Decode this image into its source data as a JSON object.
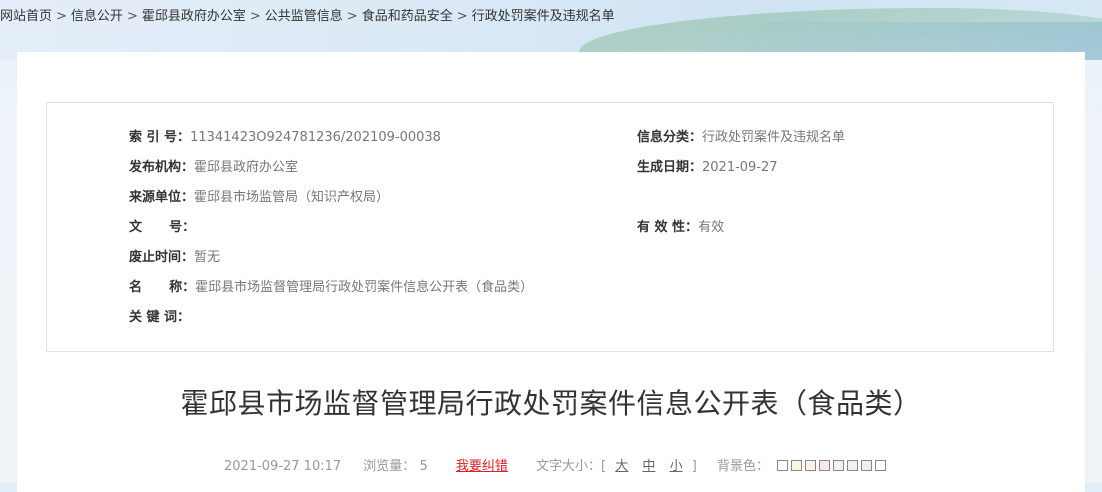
{
  "breadcrumb": [
    "网站首页",
    "信息公开",
    "霍邱县政府办公室",
    "公共监管信息",
    "食品和药品安全",
    "行政处罚案件及违规名单"
  ],
  "breadcrumb_sep": ">",
  "meta": {
    "index_label": "索 引 号：",
    "index_value": "11341423O924781236/202109-00038",
    "category_label": "信息分类：",
    "category_value": "行政处罚案件及违规名单",
    "publisher_label": "发布机构：",
    "publisher_value": "霍邱县政府办公室",
    "date_label": "生成日期：",
    "date_value": "2021-09-27",
    "source_label": "来源单位：",
    "source_value": "霍邱县市场监管局（知识产权局）",
    "docno_label": "文      号：",
    "docno_value": "",
    "validity_label": "有 效 性：",
    "validity_value": "有效",
    "expire_label": "废止时间：",
    "expire_value": "暂无",
    "name_label": "名      称：",
    "name_value": "霍邱县市场监督管理局行政处罚案件信息公开表（食品类）",
    "keywords_label": "关 键 词：",
    "keywords_value": ""
  },
  "article": {
    "title": "霍邱县市场监督管理局行政处罚案件信息公开表（食品类）"
  },
  "info_bar": {
    "datetime": "2021-09-27 10:17",
    "views_label": "浏览量：",
    "views_value": "5",
    "error_link": "我要纠错",
    "font_size_label": "文字大小：[",
    "size_large": "大",
    "size_medium": "中",
    "size_small": "小",
    "font_size_close": "]",
    "bg_label": "背景色："
  },
  "bg_colors": [
    "#ffffff",
    "#faf6e6",
    "#fdf0e6",
    "#fbe7ea",
    "#edf7e8",
    "#e8f3f8",
    "#eeeeee",
    "#ffffff"
  ]
}
